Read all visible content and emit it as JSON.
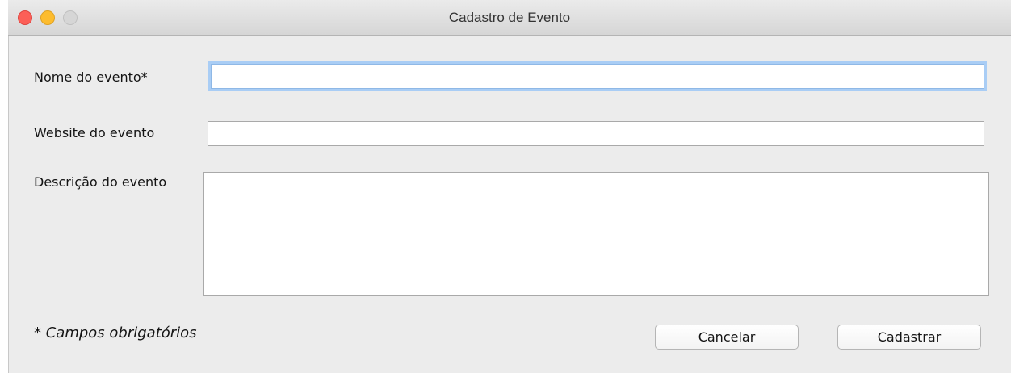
{
  "window": {
    "title": "Cadastro de Evento"
  },
  "form": {
    "name_label": "Nome do evento*",
    "name_value": "",
    "website_label": "Website do evento",
    "website_value": "",
    "description_label": "Descrição do evento",
    "description_value": ""
  },
  "footer": {
    "required_note": "* Campos obrigatórios",
    "cancel_label": "Cancelar",
    "submit_label": "Cadastrar"
  }
}
